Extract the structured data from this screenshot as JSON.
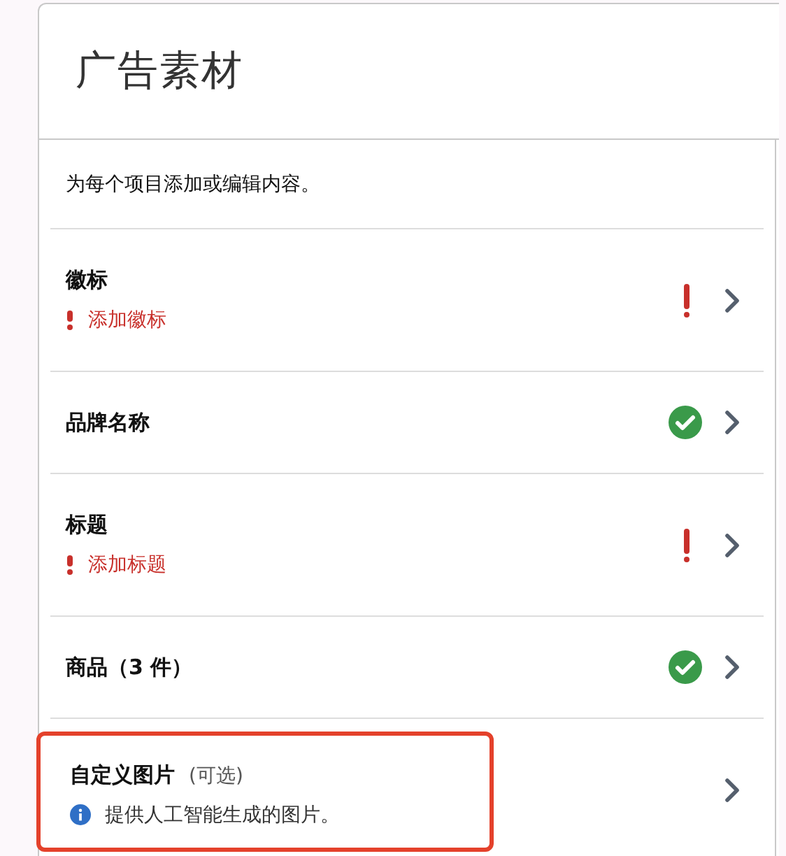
{
  "panel": {
    "title": "广告素材",
    "description": "为每个项目添加或编辑内容。"
  },
  "items": [
    {
      "label": "徽标",
      "indicator": {
        "kind": "error"
      },
      "message": {
        "kind": "error",
        "text": "添加徽标"
      },
      "highlighted": false
    },
    {
      "label": "品牌名称",
      "indicator": {
        "kind": "ok"
      },
      "highlighted": false
    },
    {
      "label": "标题",
      "indicator": {
        "kind": "error"
      },
      "message": {
        "kind": "error",
        "text": "添加标题"
      },
      "highlighted": false
    },
    {
      "label": "商品（3 件）",
      "indicator": {
        "kind": "ok"
      },
      "highlighted": false
    },
    {
      "label": "自定义图片",
      "optional": "(可选)",
      "message": {
        "kind": "info",
        "text": "提供人工智能生成的图片。"
      },
      "highlighted": true
    }
  ]
}
